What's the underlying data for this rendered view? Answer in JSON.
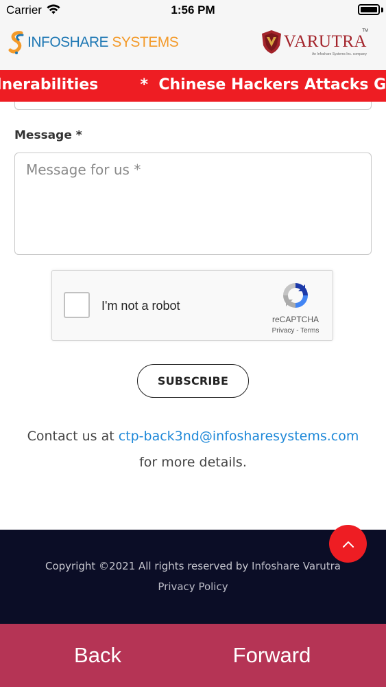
{
  "status_bar": {
    "carrier": "Carrier",
    "time": "1:56 PM"
  },
  "header": {
    "infoshare_logo": {
      "part1": "INFOSHARE",
      "part2": "SYSTEMS"
    },
    "varutra_logo": {
      "name": "VARUTRA",
      "tagline": "An Infoshare Systems Inc. company",
      "tm": "TM"
    }
  },
  "ticker": {
    "text": "lnerabilities        *  Chinese Hackers Attacks Gov",
    "background": "#ee1d23"
  },
  "form": {
    "message_label": "Message *",
    "message_placeholder": "Message for us *",
    "message_value": ""
  },
  "recaptcha": {
    "label": "I'm not a robot",
    "brand": "reCAPTCHA",
    "links": "Privacy - Terms"
  },
  "subscribe_button": {
    "label": "SUBSCRIBE"
  },
  "contact": {
    "prefix": "Contact us at ",
    "email": "ctp-back3nd@infosharesystems.com",
    "suffix": "for more details.",
    "link_color": "#1e88d8"
  },
  "footer": {
    "copyright_prefix": "Copyright ©2021 All rights reserved by ",
    "copyright_brand": "Infoshare Varutra",
    "privacy": "Privacy Policy",
    "background": "#0b0d26"
  },
  "scroll_top": {
    "icon": "chevron-up-icon",
    "color": "#ee1d23"
  },
  "bottom_nav": {
    "back": "Back",
    "forward": "Forward",
    "background": "#b53455"
  }
}
